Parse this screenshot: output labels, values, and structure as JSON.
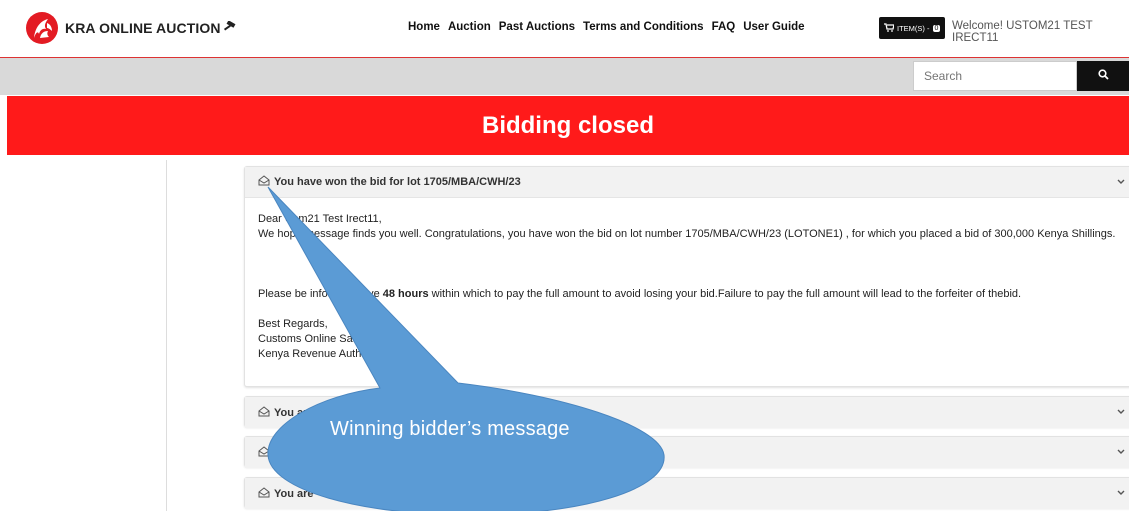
{
  "header": {
    "brand": "KRA ONLINE AUCTION",
    "nav": [
      "Home",
      "Auction",
      "Past Auctions",
      "Terms and Conditions",
      "FAQ",
      "User Guide"
    ],
    "cart": {
      "label": "ITEM(S) -",
      "count": "0"
    },
    "welcome": "Welcome! USTOM21 TEST IRECT11"
  },
  "search": {
    "placeholder": "Search"
  },
  "banner": {
    "title": "Bidding closed"
  },
  "messages": [
    {
      "title": "You have won the bid for lot 1705/MBA/CWH/23",
      "expanded": true,
      "body": {
        "greeting": "Dear Us",
        "greeting_rest": "m21 Test Irect11,",
        "line1_a": "We hope ",
        "line1_b": " message finds you well. Congratulations, you have won the bid on lot number 1705/MBA/CWH/23 (LOTONE1) , for which you placed a bid of 300,000 Kenya Shillings.",
        "line2_a": "Please be inform",
        "line2_b": "ou have ",
        "line2_bold": "48 hours",
        "line2_c": " within which to pay the full amount to avoid losing your bid.Failure to pay the full amount will lead to the forfeiter of thebid.",
        "sign1": "Best Regards,",
        "sign2": "Customs Online Sale L",
        "sign3": "Kenya Revenue Authorit"
      }
    },
    {
      "title": "You are t",
      "expanded": false
    },
    {
      "title": "Y",
      "expanded": false
    },
    {
      "title": "You are",
      "expanded": false
    }
  ],
  "callout": {
    "text": "Winning bidder’s message"
  },
  "colors": {
    "accent": "#ff1a1a",
    "callout": "#5b9bd5",
    "dark": "#111111"
  }
}
